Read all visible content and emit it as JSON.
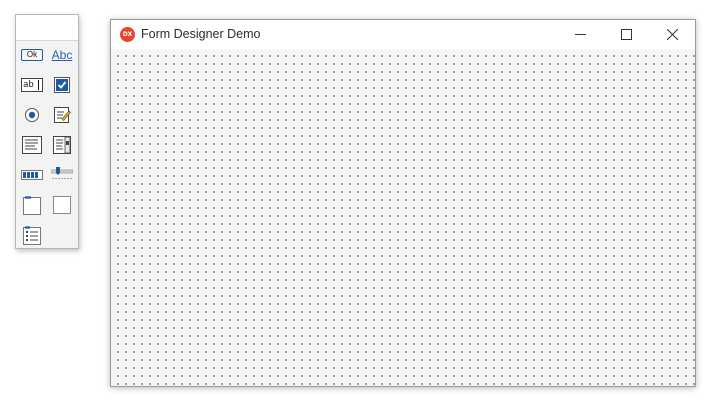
{
  "toolbox": {
    "tools": [
      {
        "name": "button-tool",
        "label": "Ok"
      },
      {
        "name": "label-tool",
        "label": "Abc"
      },
      {
        "name": "edit-tool",
        "label": "ab"
      },
      {
        "name": "checkbox-tool",
        "icon": "checkbox-checked-icon"
      },
      {
        "name": "radio-button-tool",
        "icon": "radio-button-icon"
      },
      {
        "name": "memo-tool",
        "icon": "memo-edit-icon"
      },
      {
        "name": "listbox-tool",
        "icon": "listbox-icon"
      },
      {
        "name": "combobox-tool",
        "icon": "combobox-icon"
      },
      {
        "name": "progressbar-tool",
        "icon": "progressbar-icon"
      },
      {
        "name": "trackbar-tool",
        "icon": "trackbar-icon"
      },
      {
        "name": "groupbox-tool",
        "icon": "groupbox-icon"
      },
      {
        "name": "panel-tool",
        "icon": "panel-icon"
      },
      {
        "name": "checklist-tool",
        "icon": "checklist-icon"
      }
    ]
  },
  "window": {
    "title": "Form Designer Demo",
    "icon_text": "DX",
    "icon_color": "#e4452f",
    "controls": [
      "minimize-icon",
      "maximize-icon",
      "close-icon"
    ]
  },
  "colors": {
    "accent": "#1f5aa6",
    "label_link": "#2c5fb3"
  }
}
